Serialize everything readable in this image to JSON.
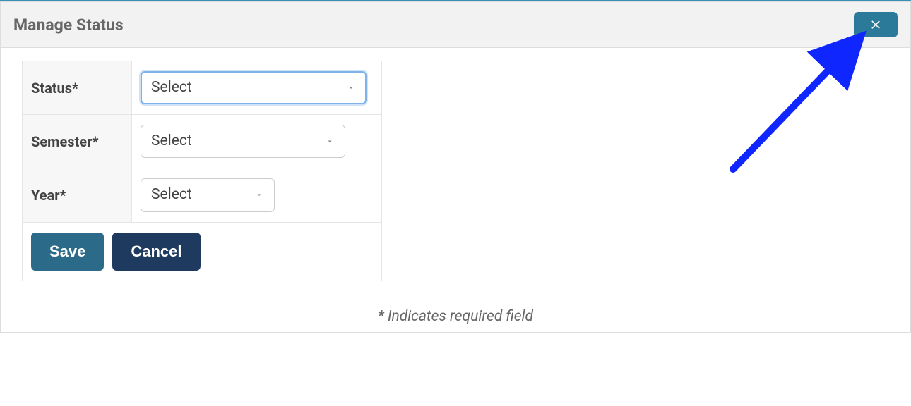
{
  "panel": {
    "title": "Manage Status",
    "close_icon": "close-icon"
  },
  "form": {
    "rows": [
      {
        "label": "Status*",
        "value": "Select",
        "focused": true,
        "width": "w1"
      },
      {
        "label": "Semester*",
        "value": "Select",
        "focused": false,
        "width": "w2"
      },
      {
        "label": "Year*",
        "value": "Select",
        "focused": false,
        "width": "w3"
      }
    ],
    "save_label": "Save",
    "cancel_label": "Cancel"
  },
  "required_note": "* Indicates required field"
}
